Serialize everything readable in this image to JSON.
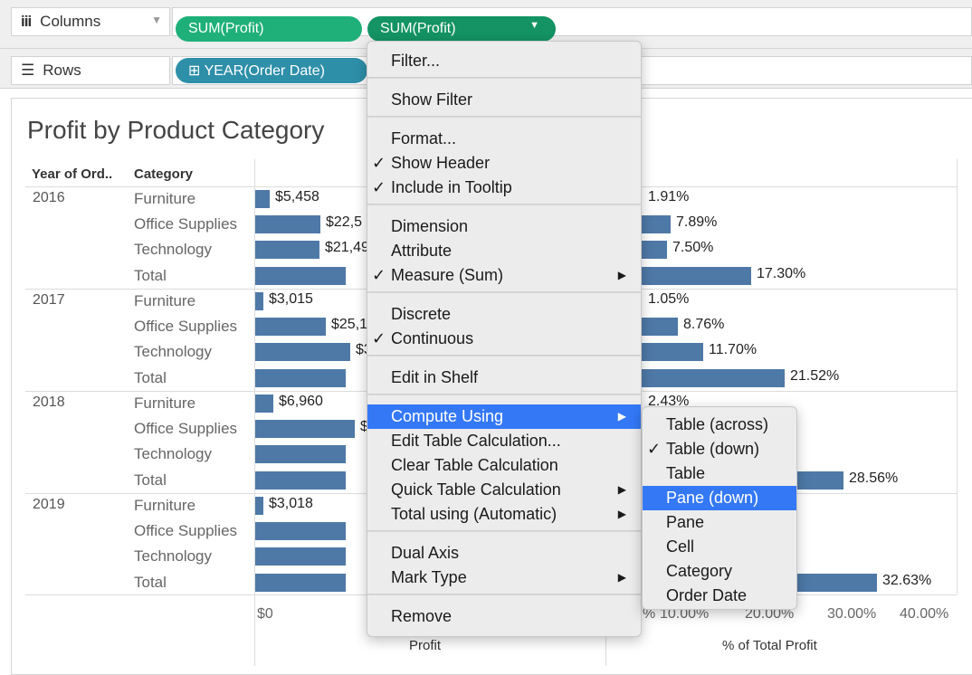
{
  "shelves": {
    "columns": {
      "label": "Columns",
      "icon": "columns-icon",
      "pills": [
        "SUM(Profit)",
        "SUM(Profit)"
      ]
    },
    "rows": {
      "label": "Rows",
      "icon": "rows-icon",
      "pills": [
        "⊞ YEAR(Order Date)"
      ]
    }
  },
  "view": {
    "title": "Profit by Product Category",
    "headers": {
      "year": "Year of Ord..",
      "category": "Category"
    },
    "groups": [
      {
        "year": "2016",
        "rows": [
          {
            "category": "Furniture",
            "profit_label": "$5,458",
            "pct_label": "1.91%"
          },
          {
            "category": "Office Supplies",
            "profit_label": "$22,5",
            "pct_label": "7.89%"
          },
          {
            "category": "Technology",
            "profit_label": "$21,49",
            "pct_label": "7.50%"
          },
          {
            "category": "Total",
            "profit_label": "",
            "pct_label": "17.30%"
          }
        ]
      },
      {
        "year": "2017",
        "rows": [
          {
            "category": "Furniture",
            "profit_label": "$3,015",
            "pct_label": "1.05%"
          },
          {
            "category": "Office Supplies",
            "profit_label": "$25,1",
            "pct_label": "8.76%"
          },
          {
            "category": "Technology",
            "profit_label": "$3",
            "pct_label": "11.70%"
          },
          {
            "category": "Total",
            "profit_label": "",
            "pct_label": "21.52%"
          }
        ]
      },
      {
        "year": "2018",
        "rows": [
          {
            "category": "Furniture",
            "profit_label": "$6,960",
            "pct_label": "2.43%"
          },
          {
            "category": "Office Supplies",
            "profit_label": "$",
            "pct_label": ""
          },
          {
            "category": "Technology",
            "profit_label": "",
            "pct_label": ""
          },
          {
            "category": "Total",
            "profit_label": "",
            "pct_label": "28.56%"
          }
        ]
      },
      {
        "year": "2019",
        "rows": [
          {
            "category": "Furniture",
            "profit_label": "$3,018",
            "pct_label": ""
          },
          {
            "category": "Office Supplies",
            "profit_label": "",
            "pct_label": ""
          },
          {
            "category": "Technology",
            "profit_label": "",
            "pct_label": "%"
          },
          {
            "category": "Total",
            "profit_label": "",
            "pct_label": "32.63%"
          }
        ]
      }
    ],
    "profit_axis": {
      "ticks": [
        "$0"
      ],
      "title": "Profit"
    },
    "pct_axis": {
      "ticks": [
        "%",
        "10.00%",
        "20.00%",
        "30.00%",
        "40.00%"
      ],
      "title": "% of Total Profit"
    }
  },
  "context_menu": {
    "items": [
      {
        "label": "Filter...",
        "checked": false,
        "submenu": false
      },
      {
        "sep": true
      },
      {
        "label": "Show Filter",
        "checked": false,
        "submenu": false
      },
      {
        "sep": true
      },
      {
        "label": "Format...",
        "checked": false,
        "submenu": false
      },
      {
        "label": "Show Header",
        "checked": true,
        "submenu": false
      },
      {
        "label": "Include in Tooltip",
        "checked": true,
        "submenu": false
      },
      {
        "sep": true
      },
      {
        "label": "Dimension",
        "checked": false,
        "submenu": false
      },
      {
        "label": "Attribute",
        "checked": false,
        "submenu": false
      },
      {
        "label": "Measure (Sum)",
        "checked": true,
        "submenu": true
      },
      {
        "sep": true
      },
      {
        "label": "Discrete",
        "checked": false,
        "submenu": false
      },
      {
        "label": "Continuous",
        "checked": true,
        "submenu": false
      },
      {
        "sep": true
      },
      {
        "label": "Edit in Shelf",
        "checked": false,
        "submenu": false
      },
      {
        "sep": true
      },
      {
        "label": "Compute Using",
        "checked": false,
        "submenu": true,
        "highlighted": true
      },
      {
        "label": "Edit Table Calculation...",
        "checked": false,
        "submenu": false
      },
      {
        "label": "Clear Table Calculation",
        "checked": false,
        "submenu": false
      },
      {
        "label": "Quick Table Calculation",
        "checked": false,
        "submenu": true
      },
      {
        "label": "Total using (Automatic)",
        "checked": false,
        "submenu": true
      },
      {
        "sep": true
      },
      {
        "label": "Dual Axis",
        "checked": false,
        "submenu": false
      },
      {
        "label": "Mark Type",
        "checked": false,
        "submenu": true
      },
      {
        "sep": true
      },
      {
        "label": "Remove",
        "checked": false,
        "submenu": false
      }
    ]
  },
  "submenu": {
    "items": [
      {
        "label": "Table (across)",
        "checked": false
      },
      {
        "label": "Table (down)",
        "checked": true
      },
      {
        "label": "Table",
        "checked": false
      },
      {
        "label": "Pane (down)",
        "checked": false,
        "highlighted": true
      },
      {
        "label": "Pane",
        "checked": false
      },
      {
        "label": "Cell",
        "checked": false
      },
      {
        "label": "Category",
        "checked": false
      },
      {
        "label": "Order Date",
        "checked": false
      }
    ]
  },
  "symbols": {
    "check": "✓",
    "arrow": "▶",
    "caret": "▼",
    "columns_icon": "iii",
    "rows_icon": "☰"
  },
  "colors": {
    "bar": "#4e79a7",
    "highlight": "#3478f6",
    "pill_green": "#1fb07a",
    "pill_blue": "#2e8fa9"
  }
}
